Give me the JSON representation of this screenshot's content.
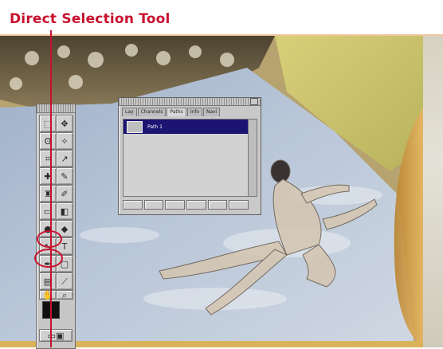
{
  "header": {
    "title": "Direct Selection Tool"
  },
  "colors": {
    "accent_red": "#c8102e",
    "rule": "#f2c59a",
    "palette_selection": "#1b1473"
  },
  "paths_palette": {
    "tabs": [
      "Lay",
      "Channels",
      "Paths",
      "Info",
      "Navi"
    ],
    "active_tab": "Paths",
    "items": [
      {
        "label": "Path 1"
      }
    ]
  },
  "toolbox": {
    "tools": [
      "marquee-icon",
      "move-icon",
      "lasso-icon",
      "magic-wand-icon",
      "crop-icon",
      "slice-icon",
      "healing-icon",
      "brush-icon",
      "stamp-icon",
      "history-brush-icon",
      "eraser-icon",
      "gradient-icon",
      "dodge-icon",
      "blur-icon",
      "direct-selection-icon",
      "type-icon",
      "pen-icon",
      "shape-icon",
      "notes-icon",
      "eyedropper-icon",
      "hand-icon",
      "zoom-icon"
    ],
    "highlighted_tools": [
      "direct-selection-icon",
      "pen-icon"
    ]
  }
}
